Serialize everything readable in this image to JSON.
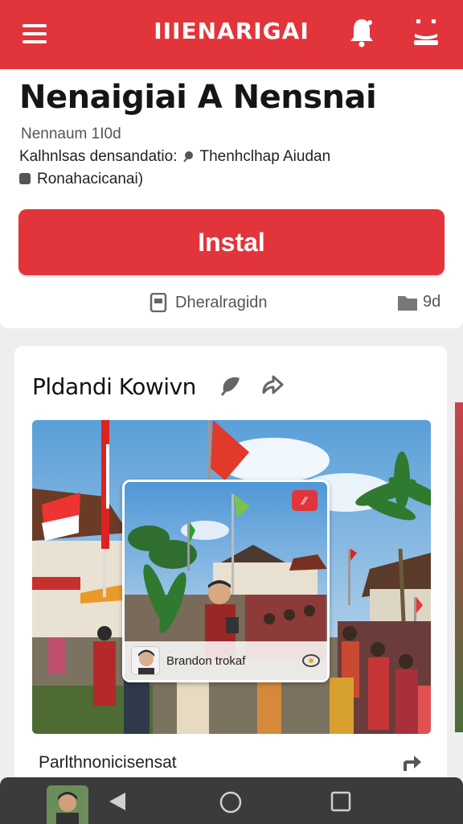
{
  "topbar": {
    "title": "IIIENARIGAI",
    "menu_icon": "hamburger-menu-icon",
    "bell_icon": "bell-icon",
    "profile_icon": "person-icon"
  },
  "app": {
    "name": "Nenaigiai A Nensnai",
    "version": "Nennaum 1I0d",
    "description_line1_a": "Kalhnlsas densandatio:",
    "description_line1_b": "Thenhclhap Aiudan",
    "description_line2": "Ronahacicanai)",
    "install_label": "Instal",
    "meta_left": "Dheralragidn",
    "meta_right": "9d"
  },
  "feed": {
    "title": "Pldandi Kowivn",
    "inset_name": "Brandon trokaf",
    "caption": "Parlthnonicisensat"
  },
  "colors": {
    "accent": "#e2353b",
    "nav": "#3b3b3b"
  }
}
